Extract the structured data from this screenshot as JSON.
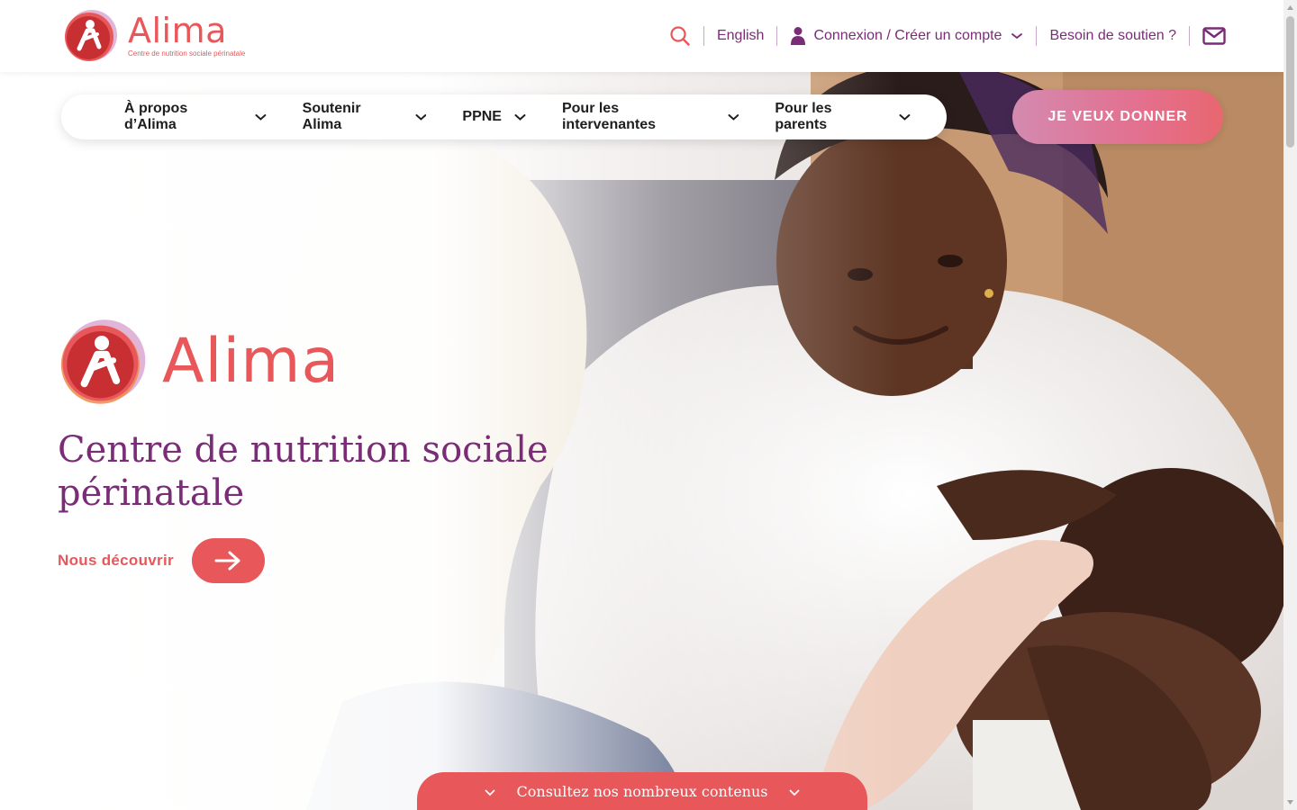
{
  "brand": {
    "name": "Alima",
    "tagline": "Centre de nutrition sociale périnatale"
  },
  "header": {
    "language_link": "English",
    "account_link": "Connexion / Créer un compte",
    "support_link": "Besoin de soutien ?"
  },
  "nav": {
    "items": [
      {
        "label": "À propos d’Alima"
      },
      {
        "label": "Soutenir Alima"
      },
      {
        "label": "PPNE"
      },
      {
        "label": "Pour les intervenantes"
      },
      {
        "label": "Pour les parents"
      }
    ],
    "donate_label": "JE VEUX DONNER"
  },
  "hero": {
    "logo_name": "Alima",
    "title": "Centre de nutrition sociale périnatale",
    "cta_label": "Nous découvrir"
  },
  "bottom_tab": {
    "label": "Consultez nos nombreux contenus"
  },
  "colors": {
    "coral": "#e8575a",
    "plum": "#7a2c76",
    "donate_gradient_start": "#d48ab0",
    "donate_gradient_end": "#e8676f"
  },
  "icons": [
    "search-icon",
    "user-icon",
    "chevron-down-icon",
    "mail-icon",
    "arrow-right-icon"
  ]
}
